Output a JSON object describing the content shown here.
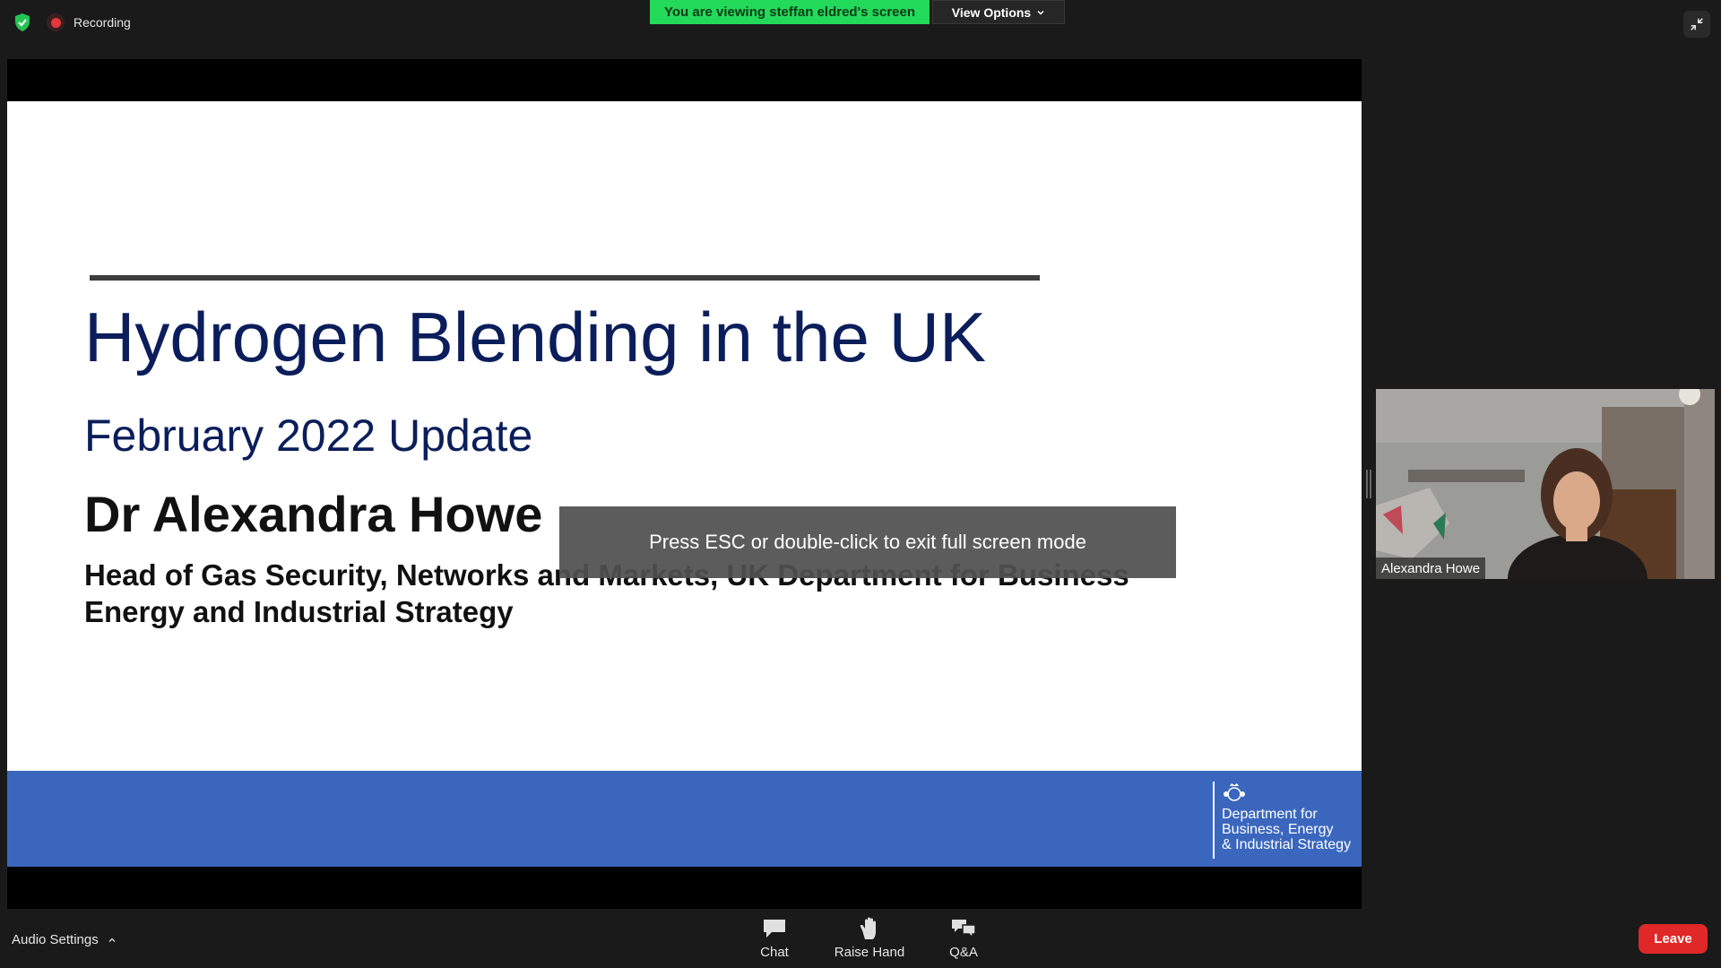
{
  "topbar": {
    "recording_label": "Recording",
    "viewing_banner": "You are viewing steffan eldred's screen",
    "view_options_label": "View Options"
  },
  "slide": {
    "title": "Hydrogen Blending in the UK",
    "subtitle": "February 2022 Update",
    "speaker": "Dr Alexandra Howe",
    "role": "Head of Gas Security, Networks and Markets, UK Department for Business Energy and Industrial Strategy",
    "logo_lines": [
      "Department for",
      "Business, Energy",
      "& Industrial Strategy"
    ]
  },
  "overlay": {
    "esc_message": "Press ESC or double-click to exit full screen mode"
  },
  "video": {
    "participant_name": "Alexandra Howe"
  },
  "toolbar": {
    "audio_settings_label": "Audio Settings",
    "chat_label": "Chat",
    "raise_hand_label": "Raise Hand",
    "qa_label": "Q&A",
    "leave_label": "Leave"
  },
  "icons": {
    "security": "shield-check-icon",
    "exit_fullscreen": "exit-fullscreen-icon",
    "chat": "chat-bubble-icon",
    "raise_hand": "hand-icon",
    "qa": "qa-bubbles-icon"
  },
  "colors": {
    "viewing_banner": "#23d959",
    "leave": "#e02828",
    "slide_footer": "#3a67bd",
    "slide_title": "#0b1e5b"
  }
}
